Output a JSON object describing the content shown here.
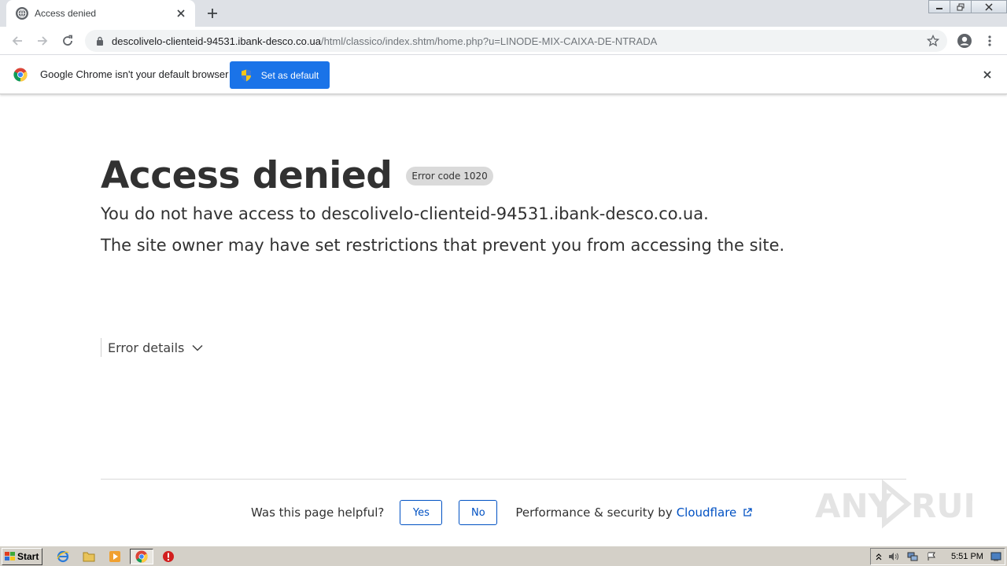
{
  "window": {
    "tab_title": "Access denied",
    "url_host": "descolivelo-clienteid-94531.ibank-desco.co.ua",
    "url_path": "/html/classico/index.shtm/home.php?u=LINODE-MIX-CAIXA-DE-NTRADA"
  },
  "infobar": {
    "message": "Google Chrome isn't your default browser",
    "button_label": "Set as default"
  },
  "page": {
    "title": "Access denied",
    "error_code": "Error code 1020",
    "message_line1": "You do not have access to descolivelo-clienteid-94531.ibank-desco.co.ua.",
    "message_line2": "The site owner may have set restrictions that prevent you from accessing the site.",
    "details_label": "Error details",
    "helpful_question": "Was this page helpful?",
    "yes_label": "Yes",
    "no_label": "No",
    "performance_text": "Performance & security by",
    "cloudflare_link": "Cloudflare"
  },
  "watermark": {
    "text_left": "ANY",
    "text_right": "RUN"
  },
  "taskbar": {
    "start_label": "Start",
    "clock": "5:51 PM",
    "pinned_icons": [
      "ie-icon",
      "explorer-folder-icon",
      "media-player-icon",
      "chrome-icon",
      "stop-icon"
    ]
  },
  "colors": {
    "accent_blue": "#1a73e8",
    "cloudflare_blue": "#0051c3",
    "title_text": "#313131",
    "badge_bg": "#dadada"
  }
}
